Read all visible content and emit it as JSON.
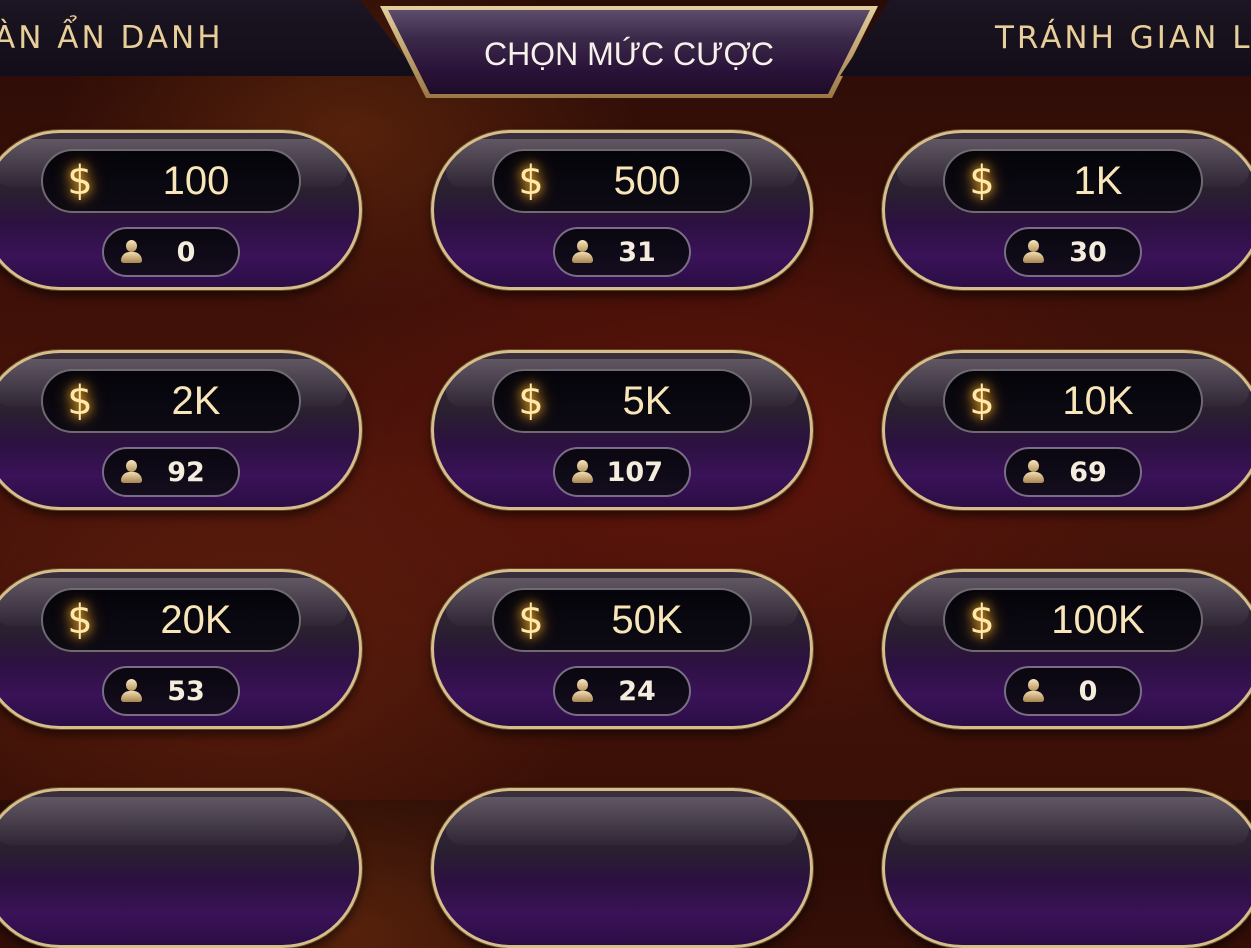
{
  "tabs": {
    "left_label": "ÀN ẨN DANH",
    "center_label": "CHỌN MỨC CƯỢC",
    "right_label": "TRÁNH GIAN L"
  },
  "currency_symbol": "$",
  "bets": [
    {
      "amount": "100",
      "players": "0"
    },
    {
      "amount": "500",
      "players": "31"
    },
    {
      "amount": "1K",
      "players": "30"
    },
    {
      "amount": "2K",
      "players": "92"
    },
    {
      "amount": "5K",
      "players": "107"
    },
    {
      "amount": "10K",
      "players": "69"
    },
    {
      "amount": "20K",
      "players": "53"
    },
    {
      "amount": "50K",
      "players": "24"
    },
    {
      "amount": "100K",
      "players": "0"
    }
  ],
  "icons": {
    "currency": "dollar-icon",
    "players": "user-icon"
  },
  "colors": {
    "gold_border": "#d6bd8a",
    "card_purple": "#3a1258",
    "text_gold": "#f8e6b8"
  }
}
